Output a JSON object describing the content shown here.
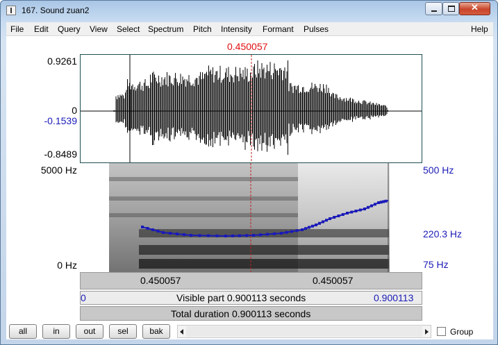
{
  "window": {
    "title": "167. Sound zuan2",
    "close_glyph": "✕"
  },
  "menu": [
    "File",
    "Edit",
    "Query",
    "View",
    "Select",
    "Spectrum",
    "Pitch",
    "Intensity",
    "Formant",
    "Pulses",
    "Help"
  ],
  "cursor": {
    "time_label": "0.450057",
    "amplitude_value": "-0.1539"
  },
  "waveform": {
    "max_label": "0.9261",
    "zero_label": "0",
    "min_label": "-0.8489"
  },
  "spectrogram": {
    "top_label": "5000 Hz",
    "bottom_label": "0 Hz"
  },
  "pitch": {
    "top_label": "500 Hz",
    "cursor_label": "220.3 Hz",
    "bottom_label": "75 Hz",
    "color": "#1a1ab8"
  },
  "bars": {
    "left_time": "0.450057",
    "right_time": "0.450057",
    "visible_start": "0",
    "visible_text": "Visible part 0.900113 seconds",
    "visible_end": "0.900113",
    "total_text": "Total duration 0.900113 seconds"
  },
  "buttons": {
    "all": "all",
    "in": "in",
    "out": "out",
    "sel": "sel",
    "bak": "bak"
  },
  "group": {
    "label": "Group",
    "checked": false
  }
}
